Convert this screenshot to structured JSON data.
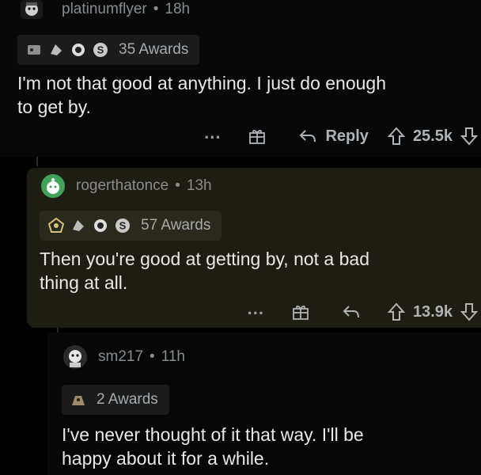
{
  "comments": [
    {
      "username": "platinumflyer",
      "age": "18h",
      "awards_label": "35 Awards",
      "body_lines": [
        "I'm not that good at anything. I just do enough",
        "to get by."
      ],
      "more_label": "...",
      "reply_label": "Reply",
      "score": "25.5k"
    },
    {
      "username": "rogerthatonce",
      "age": "13h",
      "awards_label": "57 Awards",
      "body_lines": [
        "Then you're good at getting by, not a bad",
        "thing at all."
      ],
      "more_label": "...",
      "score": "13.9k"
    },
    {
      "username": "sm217",
      "age": "11h",
      "awards_label": "2 Awards",
      "body_lines": [
        "I've never thought of it that way. I'll be",
        "happy about it for a while."
      ]
    }
  ],
  "separator": "•",
  "colors": {
    "background": "#000000",
    "highlight": "#1e1d13",
    "avatar_green": "#3fa35a"
  }
}
